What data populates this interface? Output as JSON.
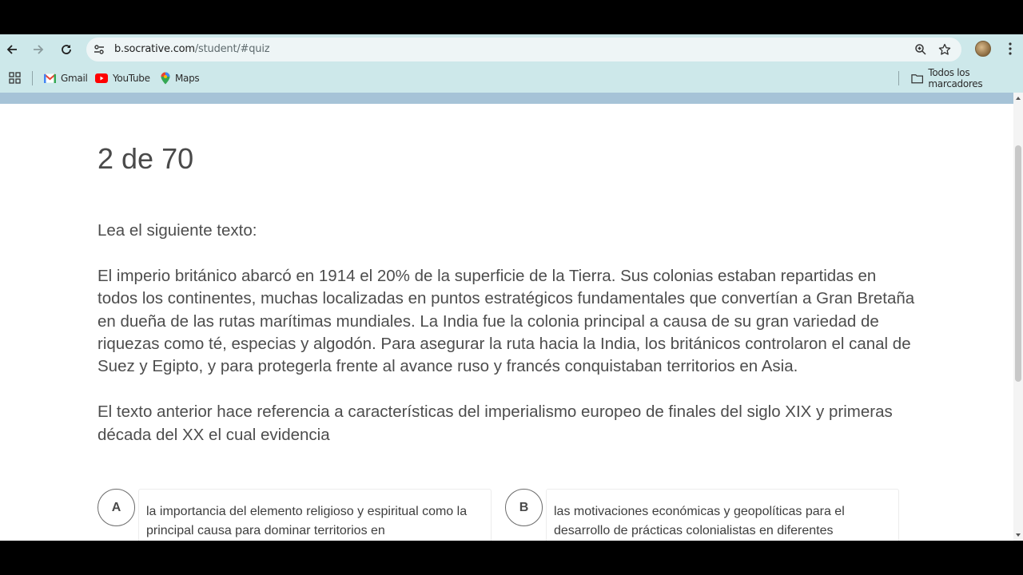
{
  "browser": {
    "url_host": "b.socrative.com",
    "url_path": "/student/#quiz",
    "bookmarks": [
      {
        "label": "Gmail"
      },
      {
        "label": "YouTube"
      },
      {
        "label": "Maps"
      }
    ],
    "all_bookmarks_label": "Todos los marcadores"
  },
  "quiz": {
    "counter": "2 de 70",
    "intro": "Lea el siguiente texto:",
    "passage": "El imperio británico abarcó en 1914 el 20% de la superficie de la Tierra. Sus colonias estaban repartidas en todos los continentes, muchas localizadas en puntos estratégicos fundamentales que convertían a Gran Bretaña en dueña de las rutas marítimas mundiales. La India fue la colonia principal a causa de su gran variedad de riquezas como té, especias y algodón. Para asegurar la ruta hacia la India, los británicos controlaron el canal de Suez y Egipto, y para protegerla frente al avance ruso y francés conquistaban territorios en Asia.",
    "prompt": "El texto anterior hace referencia a características del imperialismo europeo de finales del siglo XIX y primeras década del XX el cual evidencia",
    "answers": [
      {
        "letter": "A",
        "text": "la importancia del elemento religioso y espiritual como la principal causa para dominar territorios en"
      },
      {
        "letter": "B",
        "text": "las motivaciones económicas y geopolíticas para el desarrollo de prácticas colonialistas en diferentes"
      }
    ]
  },
  "colors": {
    "toolbar_bg": "#cde8ea",
    "page_band": "#a6c3d7"
  }
}
